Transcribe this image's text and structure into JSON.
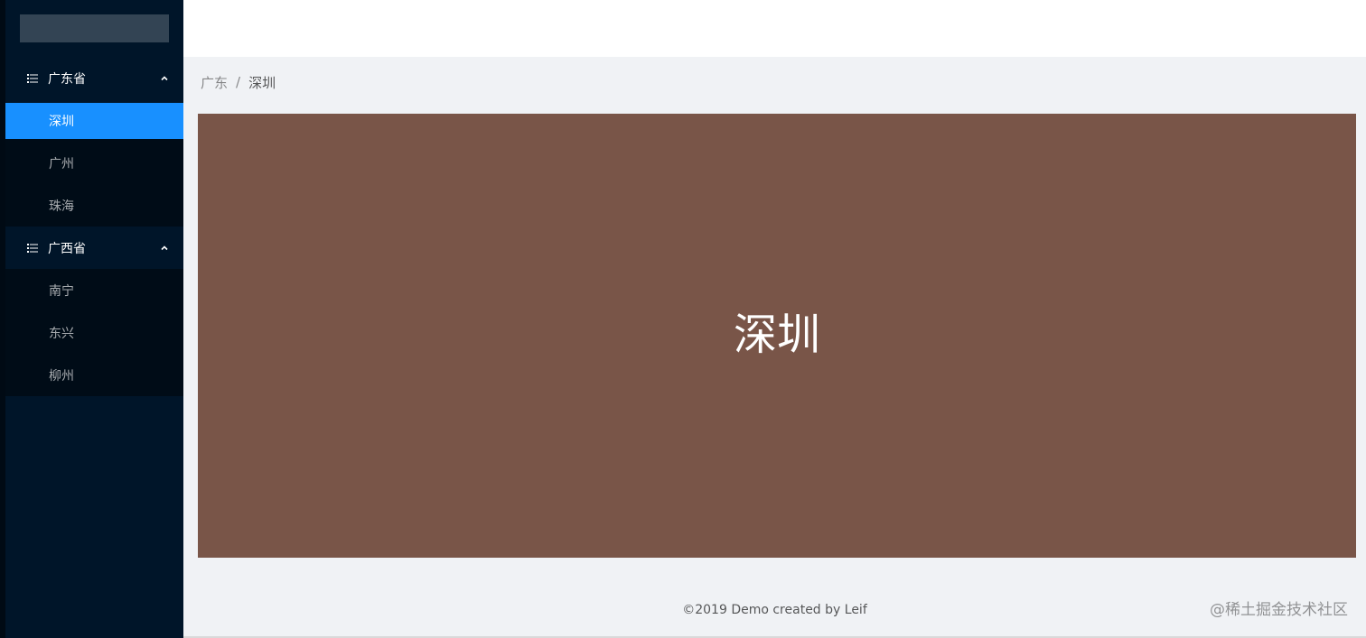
{
  "sidebar": {
    "groups": [
      {
        "title": "广东省",
        "icon": "list-icon",
        "expanded": true,
        "items": [
          {
            "label": "深圳",
            "active": true
          },
          {
            "label": "广州",
            "active": false
          },
          {
            "label": "珠海",
            "active": false
          }
        ]
      },
      {
        "title": "广西省",
        "icon": "list-icon",
        "expanded": true,
        "items": [
          {
            "label": "南宁",
            "active": false
          },
          {
            "label": "东兴",
            "active": false
          },
          {
            "label": "柳州",
            "active": false
          }
        ]
      }
    ]
  },
  "breadcrumb": {
    "items": [
      "广东",
      "深圳"
    ],
    "separator": "/"
  },
  "content": {
    "title": "深圳",
    "background": "#795548"
  },
  "footer": {
    "text": "©2019 Demo created by Leif"
  },
  "watermark": {
    "text": "@稀土掘金技术社区"
  },
  "colors": {
    "sider_bg": "#001529",
    "submenu_bg": "#000c17",
    "active_item": "#1890ff",
    "page_bg": "#f0f2f5",
    "header_bg": "#ffffff"
  }
}
